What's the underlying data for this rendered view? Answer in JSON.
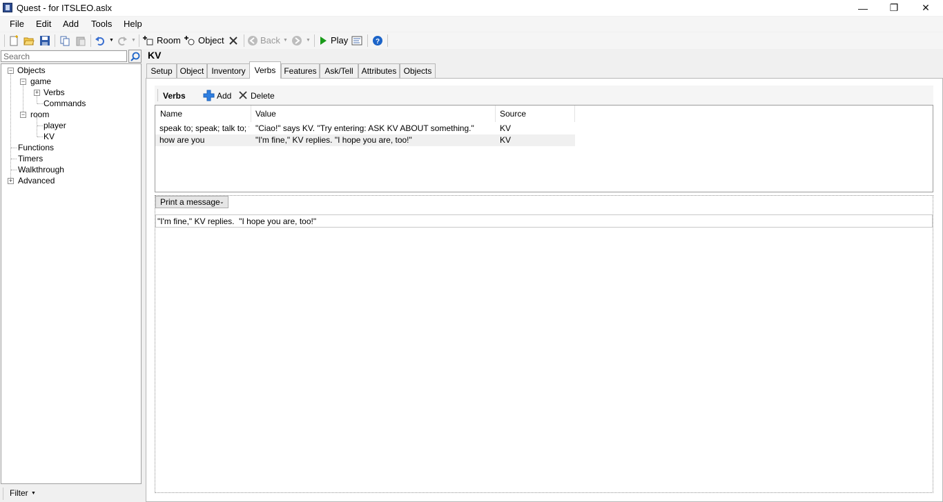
{
  "window": {
    "title": "Quest - for ITSLEO.aslx",
    "minimize": "—",
    "restore": "❐",
    "close": "✕"
  },
  "menu": {
    "file": "File",
    "edit": "Edit",
    "add": "Add",
    "tools": "Tools",
    "help": "Help"
  },
  "toolbar": {
    "room_label": "Room",
    "object_label": "Object",
    "back_label": "Back",
    "play_label": "Play"
  },
  "icons": {
    "new": "new-file-icon",
    "open": "open-folder-icon",
    "save": "save-icon",
    "copy": "copy-icon",
    "paste": "paste-icon",
    "undo": "undo-icon",
    "redo": "redo-icon",
    "add_room": "add-room-icon",
    "add_object": "add-object-icon",
    "delete": "delete-icon",
    "back": "back-icon",
    "forward": "forward-icon",
    "play": "play-icon",
    "code_view": "code-view-icon",
    "help": "help-icon",
    "search": "search-icon"
  },
  "colors": {
    "play_green": "#1a9b1a",
    "add_blue": "#2f7fe0",
    "undo_blue": "#3a6fd0",
    "help_blue": "#1c64c8"
  },
  "search": {
    "placeholder": "Search"
  },
  "tree": {
    "objects": "Objects",
    "game": "game",
    "verbs": "Verbs",
    "commands": "Commands",
    "room": "room",
    "player": "player",
    "kv": "KV",
    "functions": "Functions",
    "timers": "Timers",
    "walkthrough": "Walkthrough",
    "advanced": "Advanced"
  },
  "filter": {
    "label": "Filter"
  },
  "editor": {
    "object_title": "KV",
    "tabs": [
      {
        "label": "Setup"
      },
      {
        "label": "Object"
      },
      {
        "label": "Inventory"
      },
      {
        "label": "Verbs"
      },
      {
        "label": "Features"
      },
      {
        "label": "Ask/Tell"
      },
      {
        "label": "Attributes"
      },
      {
        "label": "Objects"
      }
    ],
    "active_tab": "Verbs",
    "verbs_section": {
      "title": "Verbs",
      "add_label": "Add",
      "delete_label": "Delete",
      "columns": [
        "Name",
        "Value",
        "Source"
      ],
      "rows": [
        {
          "name": "speak to; speak; talk to; t...",
          "value": "\"Ciao!\" says KV.  \"Try entering: ASK KV ABOUT something.\"",
          "source": "KV"
        },
        {
          "name": "how are you",
          "value": "\"I'm fine,\" KV replies.  \"I hope you are, too!\"",
          "source": "KV"
        }
      ]
    },
    "script": {
      "action": "Print a message",
      "message": "\"I'm fine,\" KV replies.  \"I hope you are, too!\""
    }
  }
}
